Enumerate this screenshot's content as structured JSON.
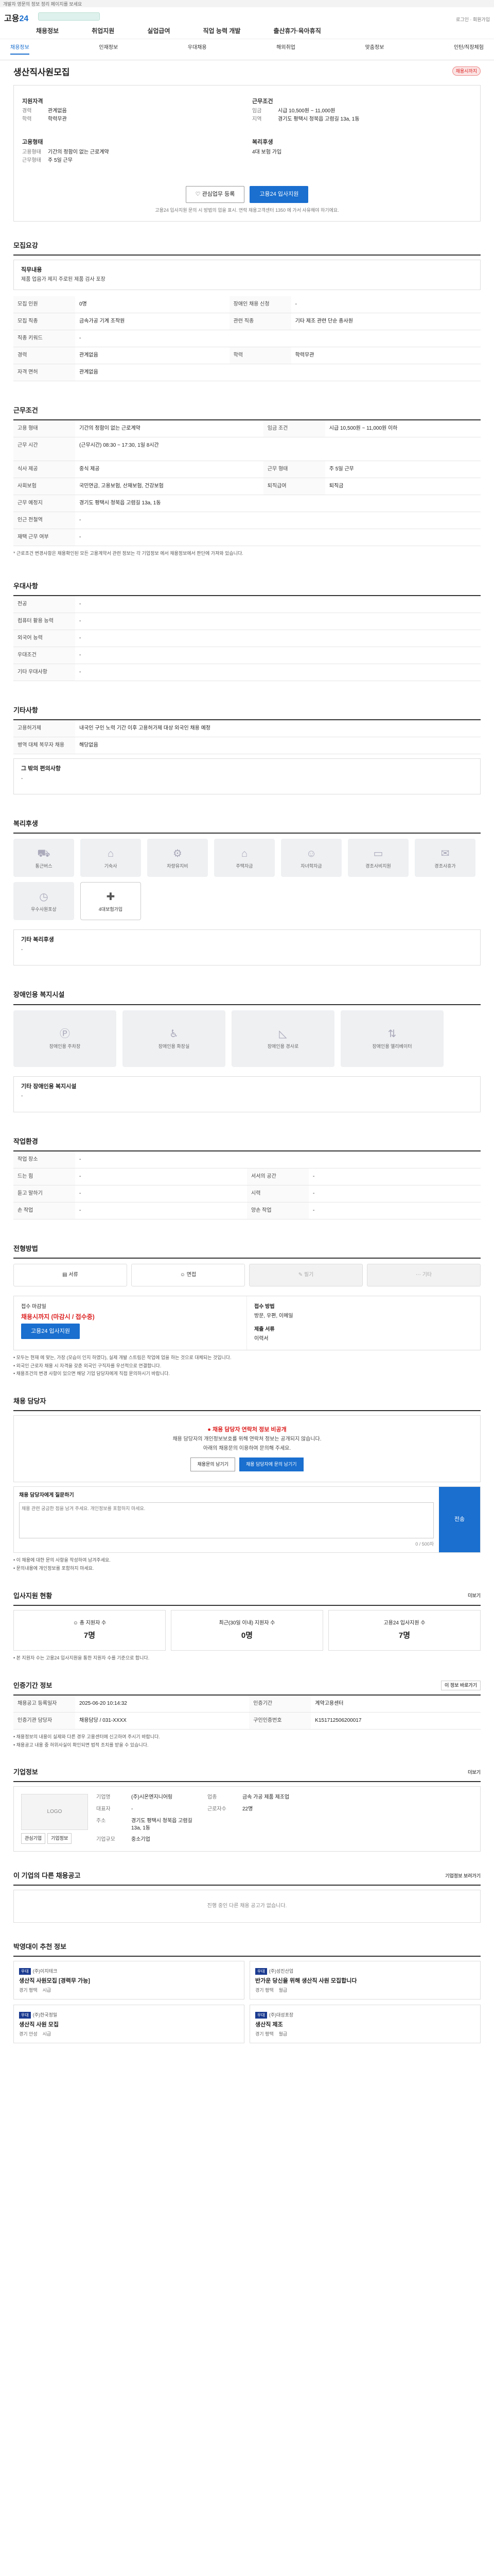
{
  "top_notice": "개발자 영문의 정보 정리 페이지를 보세요",
  "header": {
    "logo_prefix": "고용",
    "logo_suffix": "24",
    "nav": [
      "채용정보",
      "취업지원",
      "실업급여",
      "직업 능력 개발",
      "출산휴가·육아휴직"
    ],
    "right_text": "로그인 · 회원가입"
  },
  "subnav": [
    "채용정보",
    "인재정보",
    "우대채용",
    "해외취업",
    "맞춤정보",
    "인턴/직장체험"
  ],
  "job": {
    "title": "생산직사원모집",
    "badge": "채용시까지",
    "company_heading": "직원채용",
    "left_groups": [
      {
        "title": "지원자격",
        "rows": [
          {
            "k": "경력",
            "v": "관계없음"
          },
          {
            "k": "학력",
            "v": "학력무관"
          }
        ]
      },
      {
        "title": "고용형태",
        "rows": [
          {
            "k": "고용형태",
            "v": "기간의 정함이 없는 근로계약"
          },
          {
            "k": "근무형태",
            "v": "주 5일 근무"
          }
        ]
      }
    ],
    "right_groups": [
      {
        "title": "근무조건",
        "rows": [
          {
            "k": "임금",
            "v": "시급 10,500원 ~ 11,000원"
          },
          {
            "k": "지역",
            "v": "경기도 평택시 청북읍 고렴길 13a, 1동"
          }
        ]
      },
      {
        "title": "복리후생",
        "rows": [
          {
            "k": "",
            "v": "4대 보험 가입"
          }
        ]
      }
    ],
    "btn_interest": "관심업무 등록",
    "btn_apply": "고용24 입사지원",
    "note": "고용24 입사지원 문의 시 방법의 업을 표시. 연락 채용고객센터 1350 에 가서 사유해야 하기에요."
  },
  "sections": {
    "recruit_title": "모집요강",
    "recruit_panel_title": "직무내용",
    "recruit_panel_text": "제품 업음가 제지 주로된 제품 검사 포장",
    "recruit_rows": [
      {
        "k": "모집 인원",
        "v": "0명",
        "k2": "장애인 채용 신청",
        "v2": "-"
      },
      {
        "k": "모집 직종",
        "v": "금속가공 기계 조작원",
        "k2": "관련 직종",
        "v2": "기타 제조 관련 단순 종사원"
      },
      {
        "k": "직종 키워드",
        "v": "-",
        "k2": "",
        "v2": ""
      },
      {
        "k": "경력",
        "v": "관계없음",
        "k2": "학력",
        "v2": "학력무관"
      },
      {
        "k": "자격 면허",
        "v": "관계없음",
        "k2": "",
        "v2": ""
      }
    ],
    "work_title": "근무조건",
    "work_rows": [
      {
        "k": "고용 형태",
        "v": "기간의 정함이 없는 근로계약",
        "k2": "임금 조건",
        "v2": "시급 10,500원 ~ 11,000원 이하"
      },
      {
        "k": "근무 시간",
        "v": "(근무시간) 08:30 ~ 17:30, 1일 8시간",
        "k2": "",
        "v2": ""
      },
      {
        "k": "식사 제공",
        "v": "중식 제공",
        "k2": "근무 형태",
        "v2": "주 5일 근무"
      },
      {
        "k": "사회보험",
        "v": "국민연금, 고용보험, 산재보험, 건강보험",
        "k2": "퇴직급여",
        "v2": "퇴직금"
      },
      {
        "k": "근무 예정지",
        "v": "경기도 평택시 청북읍 고렴길 13a, 1동",
        "k2": "",
        "v2": ""
      },
      {
        "k": "인근 전철역",
        "v": "-",
        "k2": "",
        "v2": ""
      },
      {
        "k": "재택 근무 여부",
        "v": "-",
        "k2": "",
        "v2": ""
      }
    ],
    "work_note": "* 근로조건 변경사항은 채용확인된 모든 고용계약서 관련 정보는 각 기업정보 에서 채용정보에서 판단에 가져와 있습니다.",
    "pref_title": "우대사항",
    "pref_rows": [
      {
        "k": "전공",
        "v": "-"
      },
      {
        "k": "컴퓨터 활용 능력",
        "v": "-"
      },
      {
        "k": "외국어 능력",
        "v": "-"
      },
      {
        "k": "우대조건",
        "v": "-"
      },
      {
        "k": "기타 우대사항",
        "v": "-"
      }
    ],
    "etc_title": "기타사항",
    "etc_rows": [
      {
        "k": "고용허가제",
        "v": "내국인 구인 노력 기간 이후 고용허가제 대상 외국인 채용 예정"
      },
      {
        "k": "병역 대체 복무자 채용",
        "v": "해당없음"
      }
    ],
    "etc_panel_title": "그 밖의 편의사항",
    "etc_panel_text": "-",
    "welfare_title": "복리후생",
    "welfare_items": [
      {
        "icon": "car-icon",
        "label": "통근버스"
      },
      {
        "icon": "bus-icon",
        "label": "기숙사"
      },
      {
        "icon": "meal-icon",
        "label": "차량유지비"
      },
      {
        "icon": "house-icon",
        "label": "주택자금"
      },
      {
        "icon": "child-icon",
        "label": "자녀학자금"
      },
      {
        "icon": "bed-icon",
        "label": "경조사비지원"
      },
      {
        "icon": "gift-icon",
        "label": "경조사휴가"
      },
      {
        "icon": "clock-icon",
        "label": "우수사원포상"
      },
      {
        "icon": "medical-icon",
        "label": "4대보험가입"
      }
    ],
    "welfare_active_index": 8,
    "welfare_panel_title": "기타 복리후생",
    "welfare_panel_text": "-",
    "disabled_title": "장애인용 복지시설",
    "disabled_items": [
      {
        "icon": "parking-icon",
        "label": "장애인용 주차장"
      },
      {
        "icon": "restroom-icon",
        "label": "장애인용 화장실"
      },
      {
        "icon": "ramp-icon",
        "label": "장애인용 경사로"
      },
      {
        "icon": "elevator-icon",
        "label": "장애인용 엘리베이터"
      }
    ],
    "disabled_panel_title": "기타 장애인용 복지시설",
    "disabled_panel_text": "-",
    "env_title": "작업환경",
    "env_rows": [
      {
        "k": "작업 장소",
        "v": "-",
        "k2": "",
        "v2": ""
      },
      {
        "k": "드는 힘",
        "v": "-",
        "k2": "서서의 공간",
        "v2": "-"
      },
      {
        "k": "듣고 말하기",
        "v": "-",
        "k2": "시력",
        "v2": "-"
      },
      {
        "k": "손 작업",
        "v": "-",
        "k2": "양손 작업",
        "v2": "-"
      }
    ],
    "method_title": "전형방법",
    "methods": [
      {
        "label": "서류",
        "dim": false
      },
      {
        "label": "면접",
        "dim": false
      },
      {
        "label": "필기",
        "dim": true
      },
      {
        "label": "기타",
        "dim": true
      }
    ],
    "apply_left_label": "접수 마감일",
    "apply_left_value": "채용시까지 (마감시 / 접수중)",
    "apply_left_btn": "고용24 입사지원",
    "apply_right_label": "접수 방법",
    "apply_right_value": "방문, 우편, 이메일",
    "apply_right_label2": "제출 서류",
    "apply_right_value2": "이력서",
    "apply_notes": [
      "• 모두는 현재 에 맞는, 가장 (모습이 인지 하였다), 실제 개발 스트림은 작업에 업을 하는 것으로 대체되는 것입니다.",
      "• 외국인 근로자 채용 시 자격을 갖춘 외국인 구직자를 우선적으로 연결합니다.",
      "• 채용조건의 변경 사항이 있으면 해당 기업 담당자에게 직접 문의하시기 바랍니다."
    ],
    "contact_title": "채용 담당자",
    "contact_alert": "채용 담당자 연락처 정보 비공개",
    "contact_lines": [
      "채용 담당자의 개인정보보호를 위해 연락처 정보는 공개되지 않습니다.",
      "아래의 채용문의 이용하여 문의해 주세요."
    ],
    "contact_btn1": "채용문의 남기기",
    "contact_btn2": "채용 담당자에 문의 남기기",
    "inquiry_title": "채용 담당자에게 질문하기",
    "inquiry_placeholder": "채용 관련 궁금한 점을 남겨 주세요. 개인정보를 포함하지 마세요.",
    "inquiry_count": "0 / 500자",
    "inquiry_send": "전송",
    "inquiry_notes": [
      "• 이 채용에 대한 문의 사항을 작성하여 남겨주세요.",
      "• 문의내용에 개인정보를 포함하지 마세요."
    ],
    "stats_title": "입사지원 현황",
    "stats_more": "더보기",
    "stats": [
      {
        "label": "총 지원자 수",
        "value": "7명"
      },
      {
        "label": "최근(30일 이내) 지원자 수",
        "value": "0명"
      },
      {
        "label": "고용24 입사지원 수",
        "value": "7명"
      }
    ],
    "stats_note": "• 본 지원자 수는 고용24 입사지원을 통한 지원자 수를 기준으로 합니다.",
    "recruit_info_title": "인증기간 정보",
    "recruit_info_btn": "이 정보 바로가기",
    "recruit_info_rows": [
      {
        "k": "채용공고 등록일자",
        "v": "2025-06-20 10:14:32",
        "k2": "인증기간",
        "v2": "계약고용센터"
      },
      {
        "k": "인증기관 담당자",
        "v": "채용담당 / 031-XXXX",
        "k2": "구인인증번호",
        "v2": "K151712506200017"
      }
    ],
    "recruit_info_notes": [
      "• 채용정보의 내용이 실제와 다른 경우 고용센터에 신고하여 주시기 바랍니다.",
      "• 채용공고 내용 중 허위사실이 확인되면 법적 조치를 받을 수 있습니다."
    ],
    "company_title": "기업정보",
    "company_more": "더보기",
    "company_logo": "LOGO",
    "company_btn1": "관심기업",
    "company_btn2": "기업정보",
    "company_rows": [
      {
        "k": "기업명",
        "v": "(주)시온엔지니어링",
        "k2": "업종",
        "v2": "금속 가공 제품 제조업"
      },
      {
        "k": "대표자",
        "v": "-",
        "k2": "근로자수",
        "v2": "22명"
      },
      {
        "k": "주소",
        "v": "경기도 평택시 청북읍 고렴길 13a, 1동",
        "k2": "",
        "v2": ""
      },
      {
        "k": "기업규모",
        "v": "중소기업",
        "k2": "",
        "v2": ""
      }
    ],
    "other_jobs_title": "이 기업의 다른 채용공고",
    "other_jobs_link": "기업정보 보러가기",
    "other_jobs_empty": "진행 중인 다른 채용 공고가 없습니다.",
    "recommend_title": "박영대이 추천 정보",
    "recommend_items": [
      {
        "tag": "우대",
        "company": "(주)이지테크",
        "title": "생산직 사원모집 [경력무 가능]",
        "loc": "경기 평택",
        "pay": "시급"
      },
      {
        "tag": "우대",
        "company": "(주)성진산업",
        "title": "반가운 당신을 위해 생산직 사원 모집합니다",
        "loc": "경기 평택",
        "pay": "월급"
      },
      {
        "tag": "우대",
        "company": "(주)한국정밀",
        "title": "생산직 사원 모집",
        "loc": "경기 안성",
        "pay": "시급"
      },
      {
        "tag": "우대",
        "company": "(주)대성포장",
        "title": "생산직 제조",
        "loc": "경기 평택",
        "pay": "월급"
      }
    ]
  }
}
